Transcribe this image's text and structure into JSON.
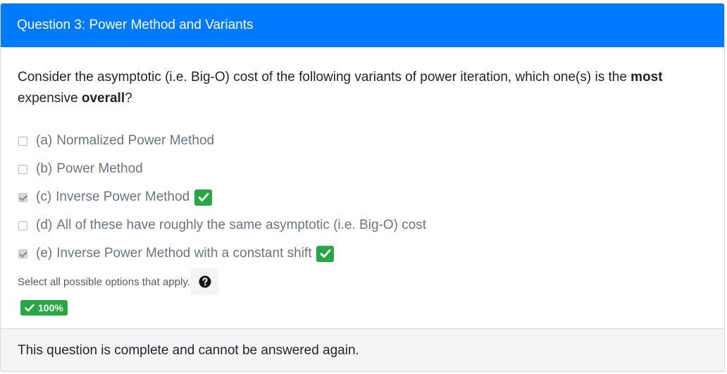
{
  "header": {
    "title": "Question 3: Power Method and Variants"
  },
  "question": {
    "text_part1": "Consider the asymptotic (i.e. Big-O) cost of the following variants of power iteration, which one(s) is the ",
    "bold1": "most",
    "text_part2": " expensive ",
    "bold2": "overall",
    "text_part3": "?"
  },
  "options": [
    {
      "key": "(a)",
      "label": "Normalized Power Method",
      "checked": false,
      "correct": false
    },
    {
      "key": "(b)",
      "label": "Power Method",
      "checked": false,
      "correct": false
    },
    {
      "key": "(c)",
      "label": "Inverse Power Method",
      "checked": true,
      "correct": true
    },
    {
      "key": "(d)",
      "label": "All of these have roughly the same asymptotic (i.e. Big-O) cost",
      "checked": false,
      "correct": false
    },
    {
      "key": "(e)",
      "label": "Inverse Power Method with a constant shift",
      "checked": true,
      "correct": true
    }
  ],
  "help": {
    "text": "Select all possible options that apply.",
    "icon": "question-circle-icon"
  },
  "score": {
    "label": "100%",
    "icon": "check-icon"
  },
  "footer": {
    "text": "This question is complete and cannot be answered again."
  },
  "colors": {
    "header_bg": "#007bff",
    "success": "#28a745",
    "footer_bg": "#f5f5f5"
  }
}
